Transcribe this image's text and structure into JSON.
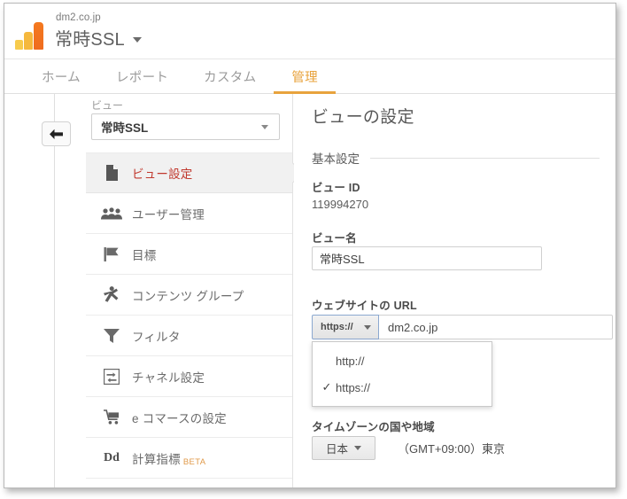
{
  "header": {
    "logo_icon": "google-analytics-logo",
    "account_name": "dm2.co.jp",
    "property_name": "常時SSL",
    "caret_icon": "caret-down-icon"
  },
  "nav": {
    "tabs": [
      {
        "label": "ホーム",
        "active": false
      },
      {
        "label": "レポート",
        "active": false
      },
      {
        "label": "カスタム",
        "active": false
      },
      {
        "label": "管理",
        "active": true
      }
    ]
  },
  "left_rail": {
    "back_icon": "arrow-left-icon"
  },
  "sidebar": {
    "view_label": "ビュー",
    "view_value": "常時SSL",
    "view_caret_icon": "caret-down-icon",
    "items": [
      {
        "label": "ビュー設定",
        "icon": "document-icon",
        "active": true,
        "badge": ""
      },
      {
        "label": "ユーザー管理",
        "icon": "people-icon",
        "active": false,
        "badge": ""
      },
      {
        "label": "目標",
        "icon": "flag-icon",
        "active": false,
        "badge": ""
      },
      {
        "label": "コンテンツ グループ",
        "icon": "person-running-icon",
        "active": false,
        "badge": ""
      },
      {
        "label": "フィルタ",
        "icon": "funnel-icon",
        "active": false,
        "badge": ""
      },
      {
        "label": "チャネル設定",
        "icon": "channel-arrows-icon",
        "active": false,
        "badge": ""
      },
      {
        "label": "e コマースの設定",
        "icon": "shopping-cart-icon",
        "active": false,
        "badge": ""
      },
      {
        "label": "計算指標",
        "icon": "dd-icon",
        "active": false,
        "badge": "BETA"
      }
    ]
  },
  "detail": {
    "title": "ビューの設定",
    "section_basic": "基本設定",
    "view_id_label": "ビュー ID",
    "view_id_value": "119994270",
    "view_name_label": "ビュー名",
    "view_name_value": "常時SSL",
    "url_label": "ウェブサイトの URL",
    "protocol_selected": "https://",
    "protocol_caret_icon": "caret-down-icon",
    "url_value": "dm2.co.jp",
    "protocol_options": [
      {
        "label": "http://",
        "checked": false
      },
      {
        "label": "https://",
        "checked": true
      }
    ],
    "check_glyph": "✓",
    "timezone_label": "タイムゾーンの国や地域",
    "timezone_country": "日本",
    "timezone_caret_icon": "caret-down-icon",
    "timezone_value": "（GMT+09:00）東京"
  },
  "colors": {
    "accent_orange": "#e8a33d",
    "active_menu_red": "#c1392e",
    "beta_badge": "#e09a4a",
    "logo_light": "#f7cb4d",
    "logo_mid": "#f5b83d",
    "logo_dark": "#f06a22"
  }
}
